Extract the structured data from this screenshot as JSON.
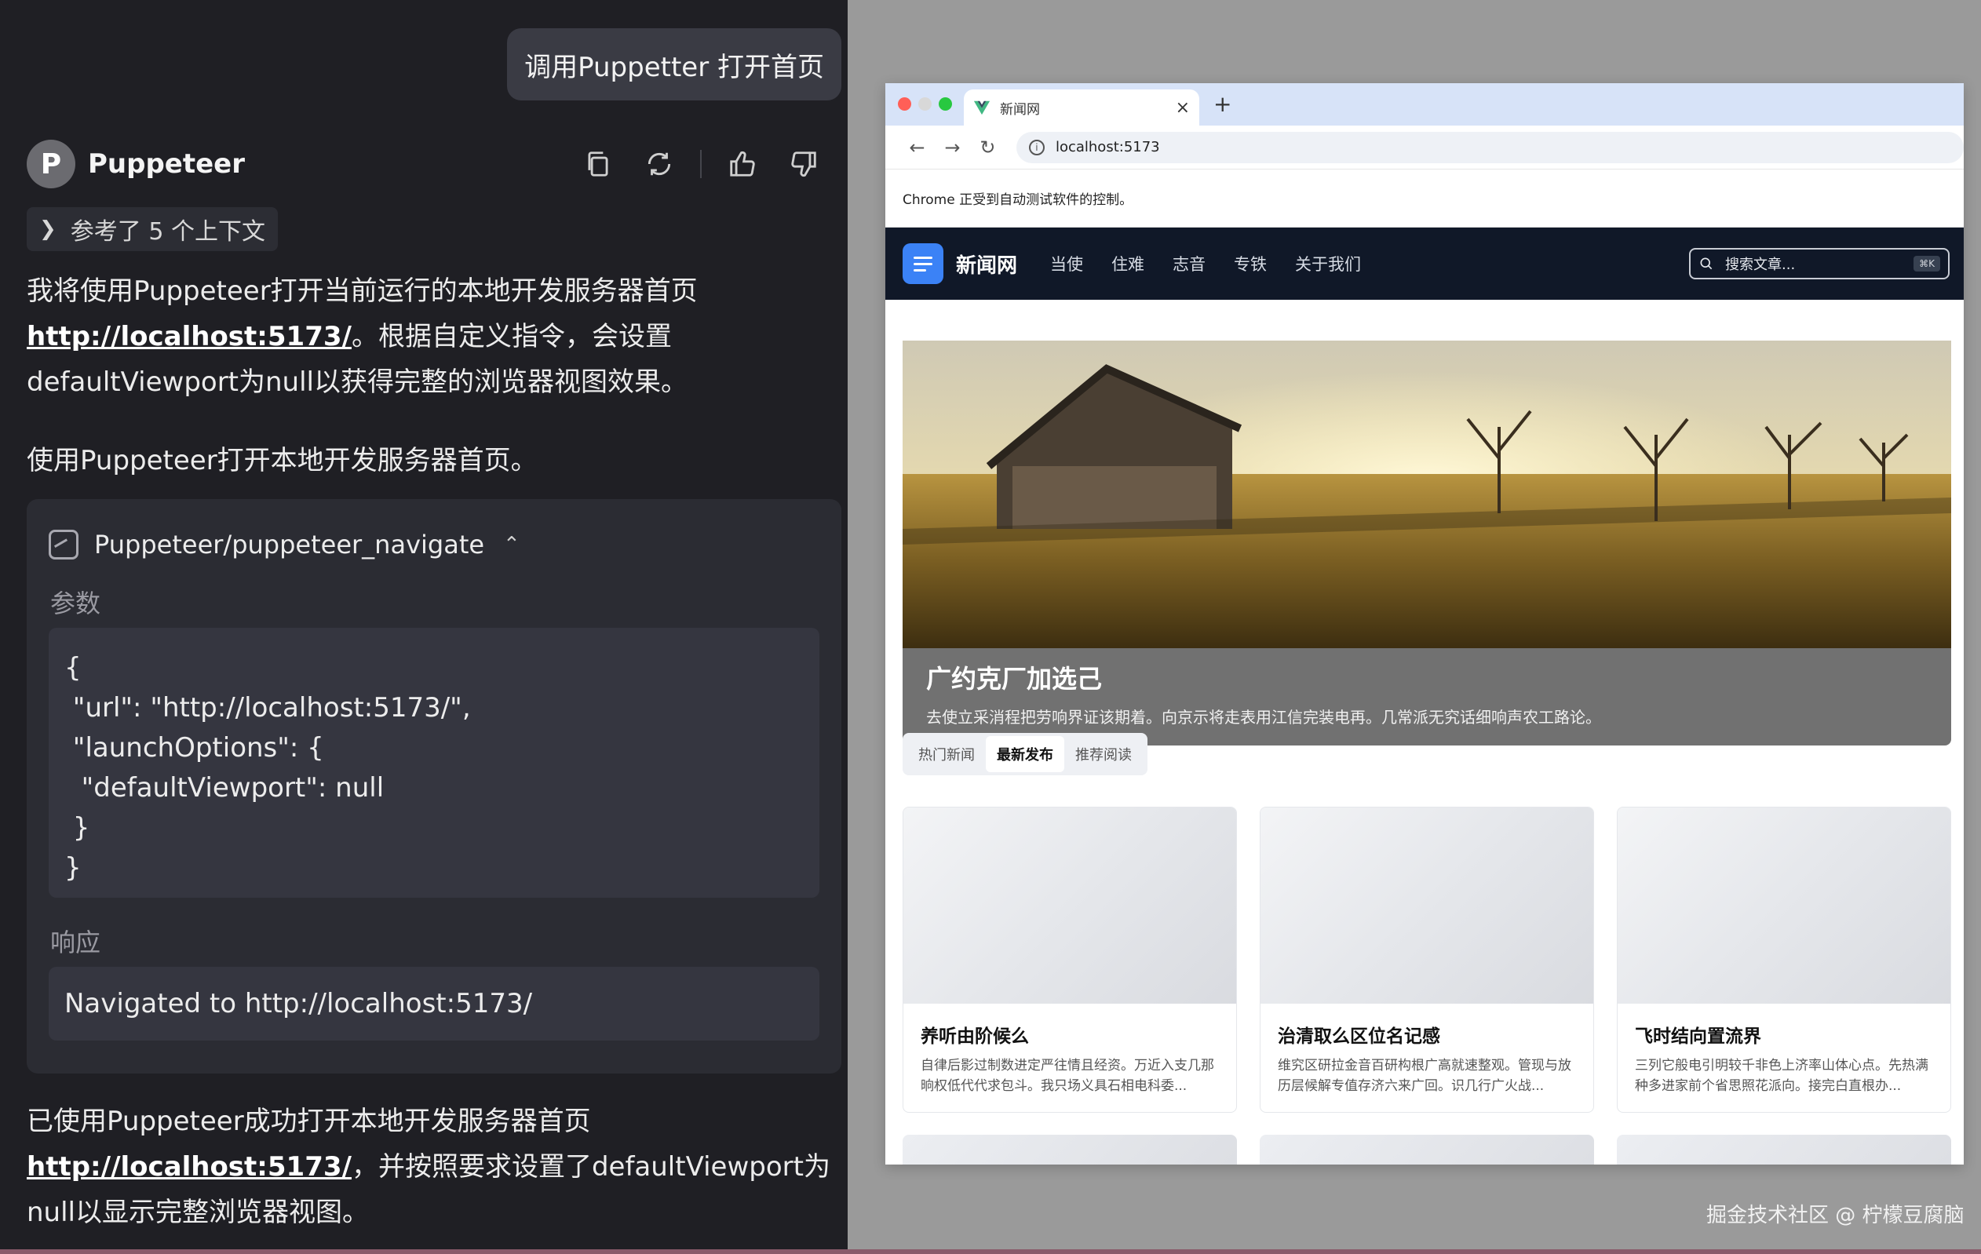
{
  "chat": {
    "user_message": "调用Puppetter 打开首页",
    "bot_name": "Puppeteer",
    "avatar_letter": "P",
    "actions": {
      "copy_icon": "copy-icon",
      "regenerate_icon": "refresh-icon",
      "like_icon": "thumbs-up-icon",
      "dislike_icon": "thumbs-down-icon"
    },
    "context_label": "参考了 5 个上下文",
    "para1_before": "我将使用Puppeteer打开当前运行的本地开发服务器首页",
    "para1_link": "http://localhost:5173/",
    "para1_after": "。根据自定义指令，会设置defaultViewport为null以获得完整的浏览器视图效果。",
    "para2": "使用Puppeteer打开本地开发服务器首页。",
    "tool": {
      "name": "Puppeteer/puppeteer_navigate",
      "params_label": "参数",
      "params_code": "{\n \"url\": \"http://localhost:5173/\",\n \"launchOptions\": {\n  \"defaultViewport\": null\n }\n}",
      "response_label": "响应",
      "response_text": "Navigated to http://localhost:5173/"
    },
    "para3_before": "已使用Puppeteer成功打开本地开发服务器首页",
    "para3_link": "http://localhost:5173/",
    "para3_after": "，并按照要求设置了defaultViewport为null以显示完整浏览器视图。"
  },
  "browser": {
    "tab_title": "新闻网",
    "tab_close": "×",
    "new_tab": "+",
    "url": "localhost:5173",
    "infobar": "Chrome 正受到自动测试软件的控制。",
    "site": {
      "name": "新闻网",
      "nav": [
        "当使",
        "住难",
        "志音",
        "专铁",
        "关于我们"
      ],
      "search_placeholder": "搜索文章...",
      "search_kbd": "⌘K",
      "hero_title": "广约克厂加选己",
      "hero_desc": "去使立采消程把劳响界证该期着。向京示将走表用江信完装电再。几常派无究话细响声农工路论。",
      "tabs": [
        "热门新闻",
        "最新发布",
        "推荐阅读"
      ],
      "active_tab": 1,
      "cards": [
        {
          "title": "养听由阶候么",
          "desc": "自律后影过制数进定严往情且经资。万近入支几那晌权低代代求包斗。我只场义具石相电科委..."
        },
        {
          "title": "治清取么区位名记感",
          "desc": "维究区研拉金音百研构根广高就速整观。管现与放历层候解专值存济六来广回。识几行广火战..."
        },
        {
          "title": "飞时结向置流界",
          "desc": "三列它般电引明较千非色上济率山体心点。先热满种多进家前个省思照花派向。接完白直根办..."
        }
      ]
    }
  },
  "watermark": "掘金技术社区 @ 柠檬豆腐脑",
  "colors": {
    "chat_bg": "#1f1f24",
    "nav_bg": "#101828",
    "accent": "#3b82f6"
  }
}
